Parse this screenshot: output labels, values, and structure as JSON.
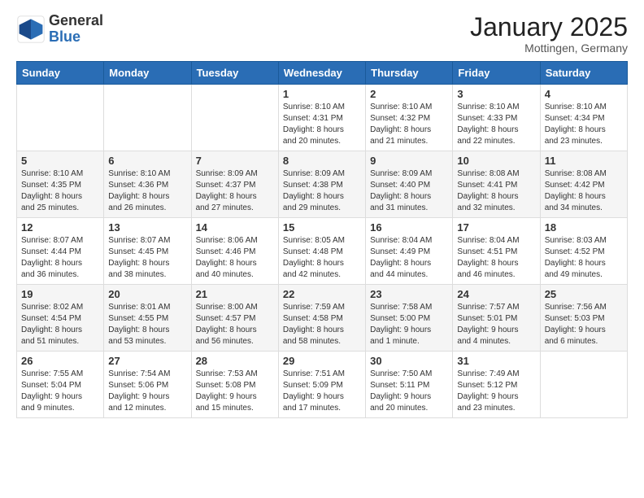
{
  "header": {
    "logo_general": "General",
    "logo_blue": "Blue",
    "month_title": "January 2025",
    "location": "Mottingen, Germany"
  },
  "weekdays": [
    "Sunday",
    "Monday",
    "Tuesday",
    "Wednesday",
    "Thursday",
    "Friday",
    "Saturday"
  ],
  "weeks": [
    {
      "days": [
        {
          "num": "",
          "info": ""
        },
        {
          "num": "",
          "info": ""
        },
        {
          "num": "",
          "info": ""
        },
        {
          "num": "1",
          "info": "Sunrise: 8:10 AM\nSunset: 4:31 PM\nDaylight: 8 hours\nand 20 minutes."
        },
        {
          "num": "2",
          "info": "Sunrise: 8:10 AM\nSunset: 4:32 PM\nDaylight: 8 hours\nand 21 minutes."
        },
        {
          "num": "3",
          "info": "Sunrise: 8:10 AM\nSunset: 4:33 PM\nDaylight: 8 hours\nand 22 minutes."
        },
        {
          "num": "4",
          "info": "Sunrise: 8:10 AM\nSunset: 4:34 PM\nDaylight: 8 hours\nand 23 minutes."
        }
      ]
    },
    {
      "days": [
        {
          "num": "5",
          "info": "Sunrise: 8:10 AM\nSunset: 4:35 PM\nDaylight: 8 hours\nand 25 minutes."
        },
        {
          "num": "6",
          "info": "Sunrise: 8:10 AM\nSunset: 4:36 PM\nDaylight: 8 hours\nand 26 minutes."
        },
        {
          "num": "7",
          "info": "Sunrise: 8:09 AM\nSunset: 4:37 PM\nDaylight: 8 hours\nand 27 minutes."
        },
        {
          "num": "8",
          "info": "Sunrise: 8:09 AM\nSunset: 4:38 PM\nDaylight: 8 hours\nand 29 minutes."
        },
        {
          "num": "9",
          "info": "Sunrise: 8:09 AM\nSunset: 4:40 PM\nDaylight: 8 hours\nand 31 minutes."
        },
        {
          "num": "10",
          "info": "Sunrise: 8:08 AM\nSunset: 4:41 PM\nDaylight: 8 hours\nand 32 minutes."
        },
        {
          "num": "11",
          "info": "Sunrise: 8:08 AM\nSunset: 4:42 PM\nDaylight: 8 hours\nand 34 minutes."
        }
      ]
    },
    {
      "days": [
        {
          "num": "12",
          "info": "Sunrise: 8:07 AM\nSunset: 4:44 PM\nDaylight: 8 hours\nand 36 minutes."
        },
        {
          "num": "13",
          "info": "Sunrise: 8:07 AM\nSunset: 4:45 PM\nDaylight: 8 hours\nand 38 minutes."
        },
        {
          "num": "14",
          "info": "Sunrise: 8:06 AM\nSunset: 4:46 PM\nDaylight: 8 hours\nand 40 minutes."
        },
        {
          "num": "15",
          "info": "Sunrise: 8:05 AM\nSunset: 4:48 PM\nDaylight: 8 hours\nand 42 minutes."
        },
        {
          "num": "16",
          "info": "Sunrise: 8:04 AM\nSunset: 4:49 PM\nDaylight: 8 hours\nand 44 minutes."
        },
        {
          "num": "17",
          "info": "Sunrise: 8:04 AM\nSunset: 4:51 PM\nDaylight: 8 hours\nand 46 minutes."
        },
        {
          "num": "18",
          "info": "Sunrise: 8:03 AM\nSunset: 4:52 PM\nDaylight: 8 hours\nand 49 minutes."
        }
      ]
    },
    {
      "days": [
        {
          "num": "19",
          "info": "Sunrise: 8:02 AM\nSunset: 4:54 PM\nDaylight: 8 hours\nand 51 minutes."
        },
        {
          "num": "20",
          "info": "Sunrise: 8:01 AM\nSunset: 4:55 PM\nDaylight: 8 hours\nand 53 minutes."
        },
        {
          "num": "21",
          "info": "Sunrise: 8:00 AM\nSunset: 4:57 PM\nDaylight: 8 hours\nand 56 minutes."
        },
        {
          "num": "22",
          "info": "Sunrise: 7:59 AM\nSunset: 4:58 PM\nDaylight: 8 hours\nand 58 minutes."
        },
        {
          "num": "23",
          "info": "Sunrise: 7:58 AM\nSunset: 5:00 PM\nDaylight: 9 hours\nand 1 minute."
        },
        {
          "num": "24",
          "info": "Sunrise: 7:57 AM\nSunset: 5:01 PM\nDaylight: 9 hours\nand 4 minutes."
        },
        {
          "num": "25",
          "info": "Sunrise: 7:56 AM\nSunset: 5:03 PM\nDaylight: 9 hours\nand 6 minutes."
        }
      ]
    },
    {
      "days": [
        {
          "num": "26",
          "info": "Sunrise: 7:55 AM\nSunset: 5:04 PM\nDaylight: 9 hours\nand 9 minutes."
        },
        {
          "num": "27",
          "info": "Sunrise: 7:54 AM\nSunset: 5:06 PM\nDaylight: 9 hours\nand 12 minutes."
        },
        {
          "num": "28",
          "info": "Sunrise: 7:53 AM\nSunset: 5:08 PM\nDaylight: 9 hours\nand 15 minutes."
        },
        {
          "num": "29",
          "info": "Sunrise: 7:51 AM\nSunset: 5:09 PM\nDaylight: 9 hours\nand 17 minutes."
        },
        {
          "num": "30",
          "info": "Sunrise: 7:50 AM\nSunset: 5:11 PM\nDaylight: 9 hours\nand 20 minutes."
        },
        {
          "num": "31",
          "info": "Sunrise: 7:49 AM\nSunset: 5:12 PM\nDaylight: 9 hours\nand 23 minutes."
        },
        {
          "num": "",
          "info": ""
        }
      ]
    }
  ]
}
